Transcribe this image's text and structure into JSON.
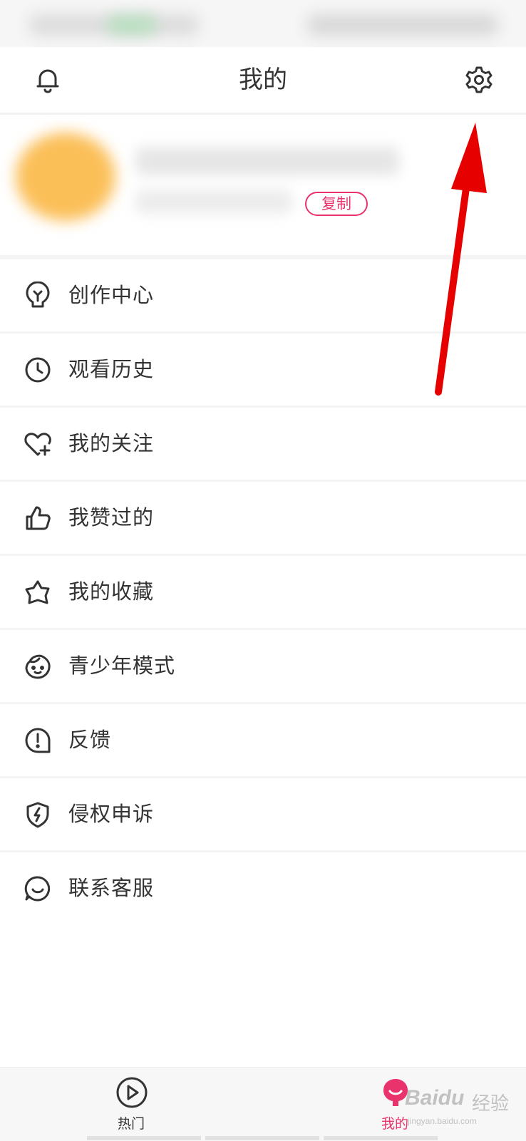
{
  "header": {
    "title": "我的"
  },
  "profile": {
    "copy_label": "复制"
  },
  "menu": {
    "items": [
      {
        "label": "创作中心",
        "icon": "lightbulb-icon"
      },
      {
        "label": "观看历史",
        "icon": "clock-icon"
      },
      {
        "label": "我的关注",
        "icon": "heart-plus-icon"
      },
      {
        "label": "我赞过的",
        "icon": "thumbs-up-icon"
      },
      {
        "label": "我的收藏",
        "icon": "star-icon"
      },
      {
        "label": "青少年模式",
        "icon": "child-face-icon"
      },
      {
        "label": "反馈",
        "icon": "exclamation-circle-icon"
      },
      {
        "label": "侵权申诉",
        "icon": "shield-lightning-icon"
      },
      {
        "label": "联系客服",
        "icon": "chat-smile-icon"
      }
    ]
  },
  "bottom_nav": {
    "tabs": [
      {
        "label": "热门",
        "icon": "play-circle-icon",
        "active": false
      },
      {
        "label": "我的",
        "icon": "profile-mascot-icon",
        "active": true
      }
    ]
  },
  "watermark": {
    "brand": "Baidu",
    "cn": "经验",
    "url": "jingyan.baidu.com"
  },
  "colors": {
    "accent": "#e8336c",
    "arrow": "#e60000",
    "icon": "#333333"
  }
}
